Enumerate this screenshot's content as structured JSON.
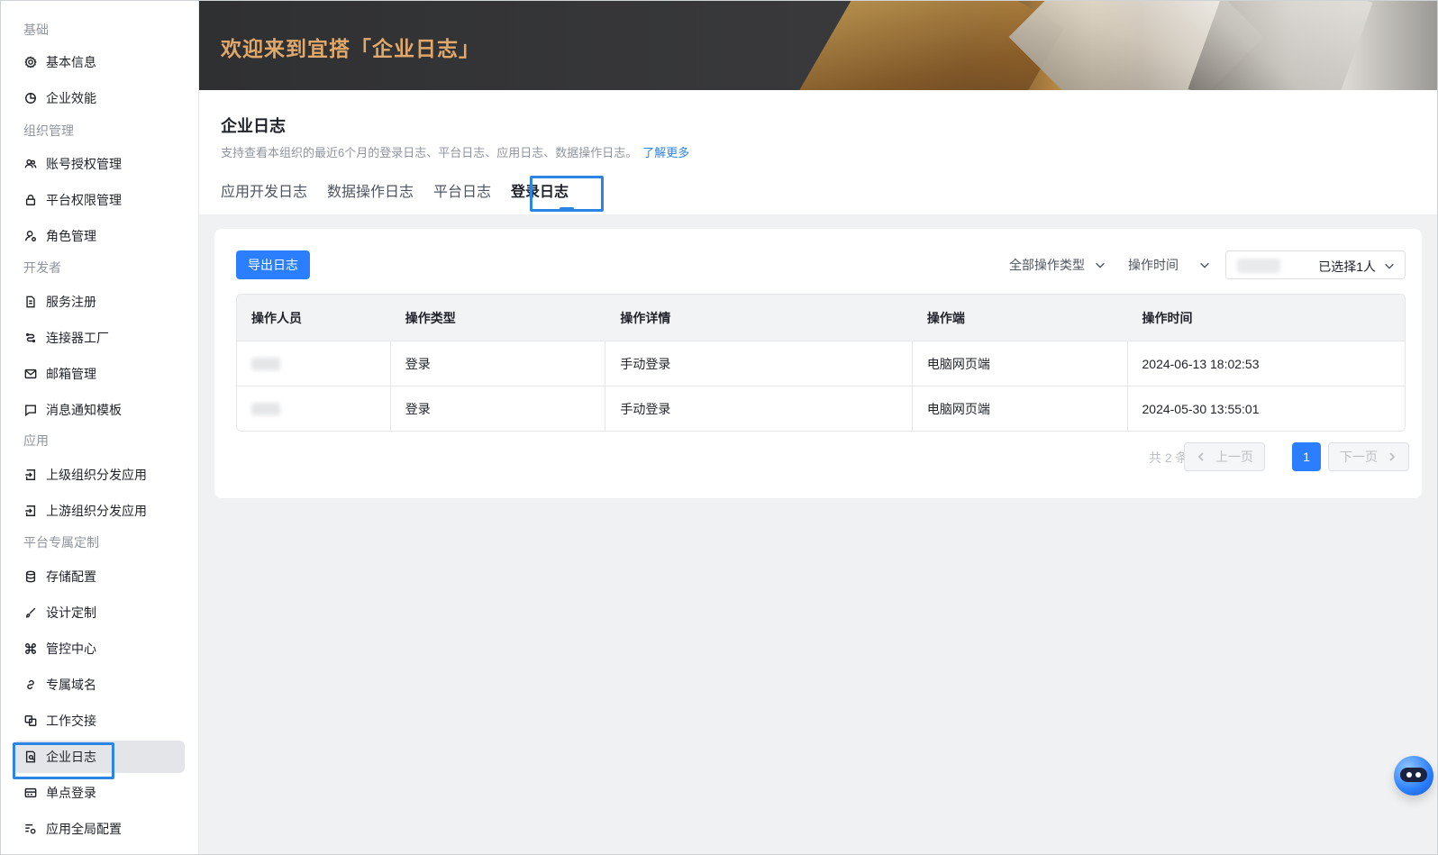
{
  "banner": {
    "title": "欢迎来到宜搭「企业日志」"
  },
  "sidebar": {
    "groups": [
      {
        "title": "基础",
        "items": [
          {
            "label": "基本信息",
            "icon": "gear-icon"
          },
          {
            "label": "企业效能",
            "icon": "chart-pie-icon"
          }
        ]
      },
      {
        "title": "组织管理",
        "items": [
          {
            "label": "账号授权管理",
            "icon": "users-icon"
          },
          {
            "label": "平台权限管理",
            "icon": "lock-icon"
          },
          {
            "label": "角色管理",
            "icon": "user-role-icon"
          }
        ]
      },
      {
        "title": "开发者",
        "items": [
          {
            "label": "服务注册",
            "icon": "document-icon"
          },
          {
            "label": "连接器工厂",
            "icon": "connector-icon"
          },
          {
            "label": "邮箱管理",
            "icon": "mail-icon"
          },
          {
            "label": "消息通知模板",
            "icon": "message-icon"
          }
        ]
      },
      {
        "title": "应用",
        "items": [
          {
            "label": "上级组织分发应用",
            "icon": "login-icon"
          },
          {
            "label": "上游组织分发应用",
            "icon": "login-icon"
          }
        ]
      },
      {
        "title": "平台专属定制",
        "items": [
          {
            "label": "存储配置",
            "icon": "database-icon"
          },
          {
            "label": "设计定制",
            "icon": "brush-icon"
          },
          {
            "label": "管控中心",
            "icon": "command-icon"
          },
          {
            "label": "专属域名",
            "icon": "link-icon"
          },
          {
            "label": "工作交接",
            "icon": "handover-icon"
          },
          {
            "label": "企业日志",
            "icon": "log-icon",
            "active": true
          },
          {
            "label": "单点登录",
            "icon": "sso-icon"
          },
          {
            "label": "应用全局配置",
            "icon": "settings-list-icon"
          }
        ]
      }
    ]
  },
  "header": {
    "title": "企业日志",
    "description": "支持查看本组织的最近6个月的登录日志、平台日志、应用日志、数据操作日志。",
    "learn_more": "了解更多",
    "tabs": [
      {
        "label": "应用开发日志"
      },
      {
        "label": "数据操作日志"
      },
      {
        "label": "平台日志"
      },
      {
        "label": "登录日志",
        "active": true
      }
    ]
  },
  "toolbar": {
    "export_label": "导出日志",
    "filter_type": "全部操作类型",
    "filter_time": "操作时间",
    "person_selected": "已选择1人"
  },
  "table": {
    "columns": [
      "操作人员",
      "操作类型",
      "操作详情",
      "操作端",
      "操作时间"
    ],
    "rows": [
      {
        "type": "登录",
        "detail": "手动登录",
        "client": "电脑网页端",
        "time": "2024-06-13 18:02:53"
      },
      {
        "type": "登录",
        "detail": "手动登录",
        "client": "电脑网页端",
        "time": "2024-05-30 13:55:01"
      }
    ]
  },
  "pagination": {
    "total": "共 2 条",
    "prev": "上一页",
    "next": "下一页",
    "current": "1"
  },
  "colors": {
    "accent": "#2b7fff",
    "highlight_outline": "#2b85e4",
    "banner_title": "#e0a86a"
  }
}
